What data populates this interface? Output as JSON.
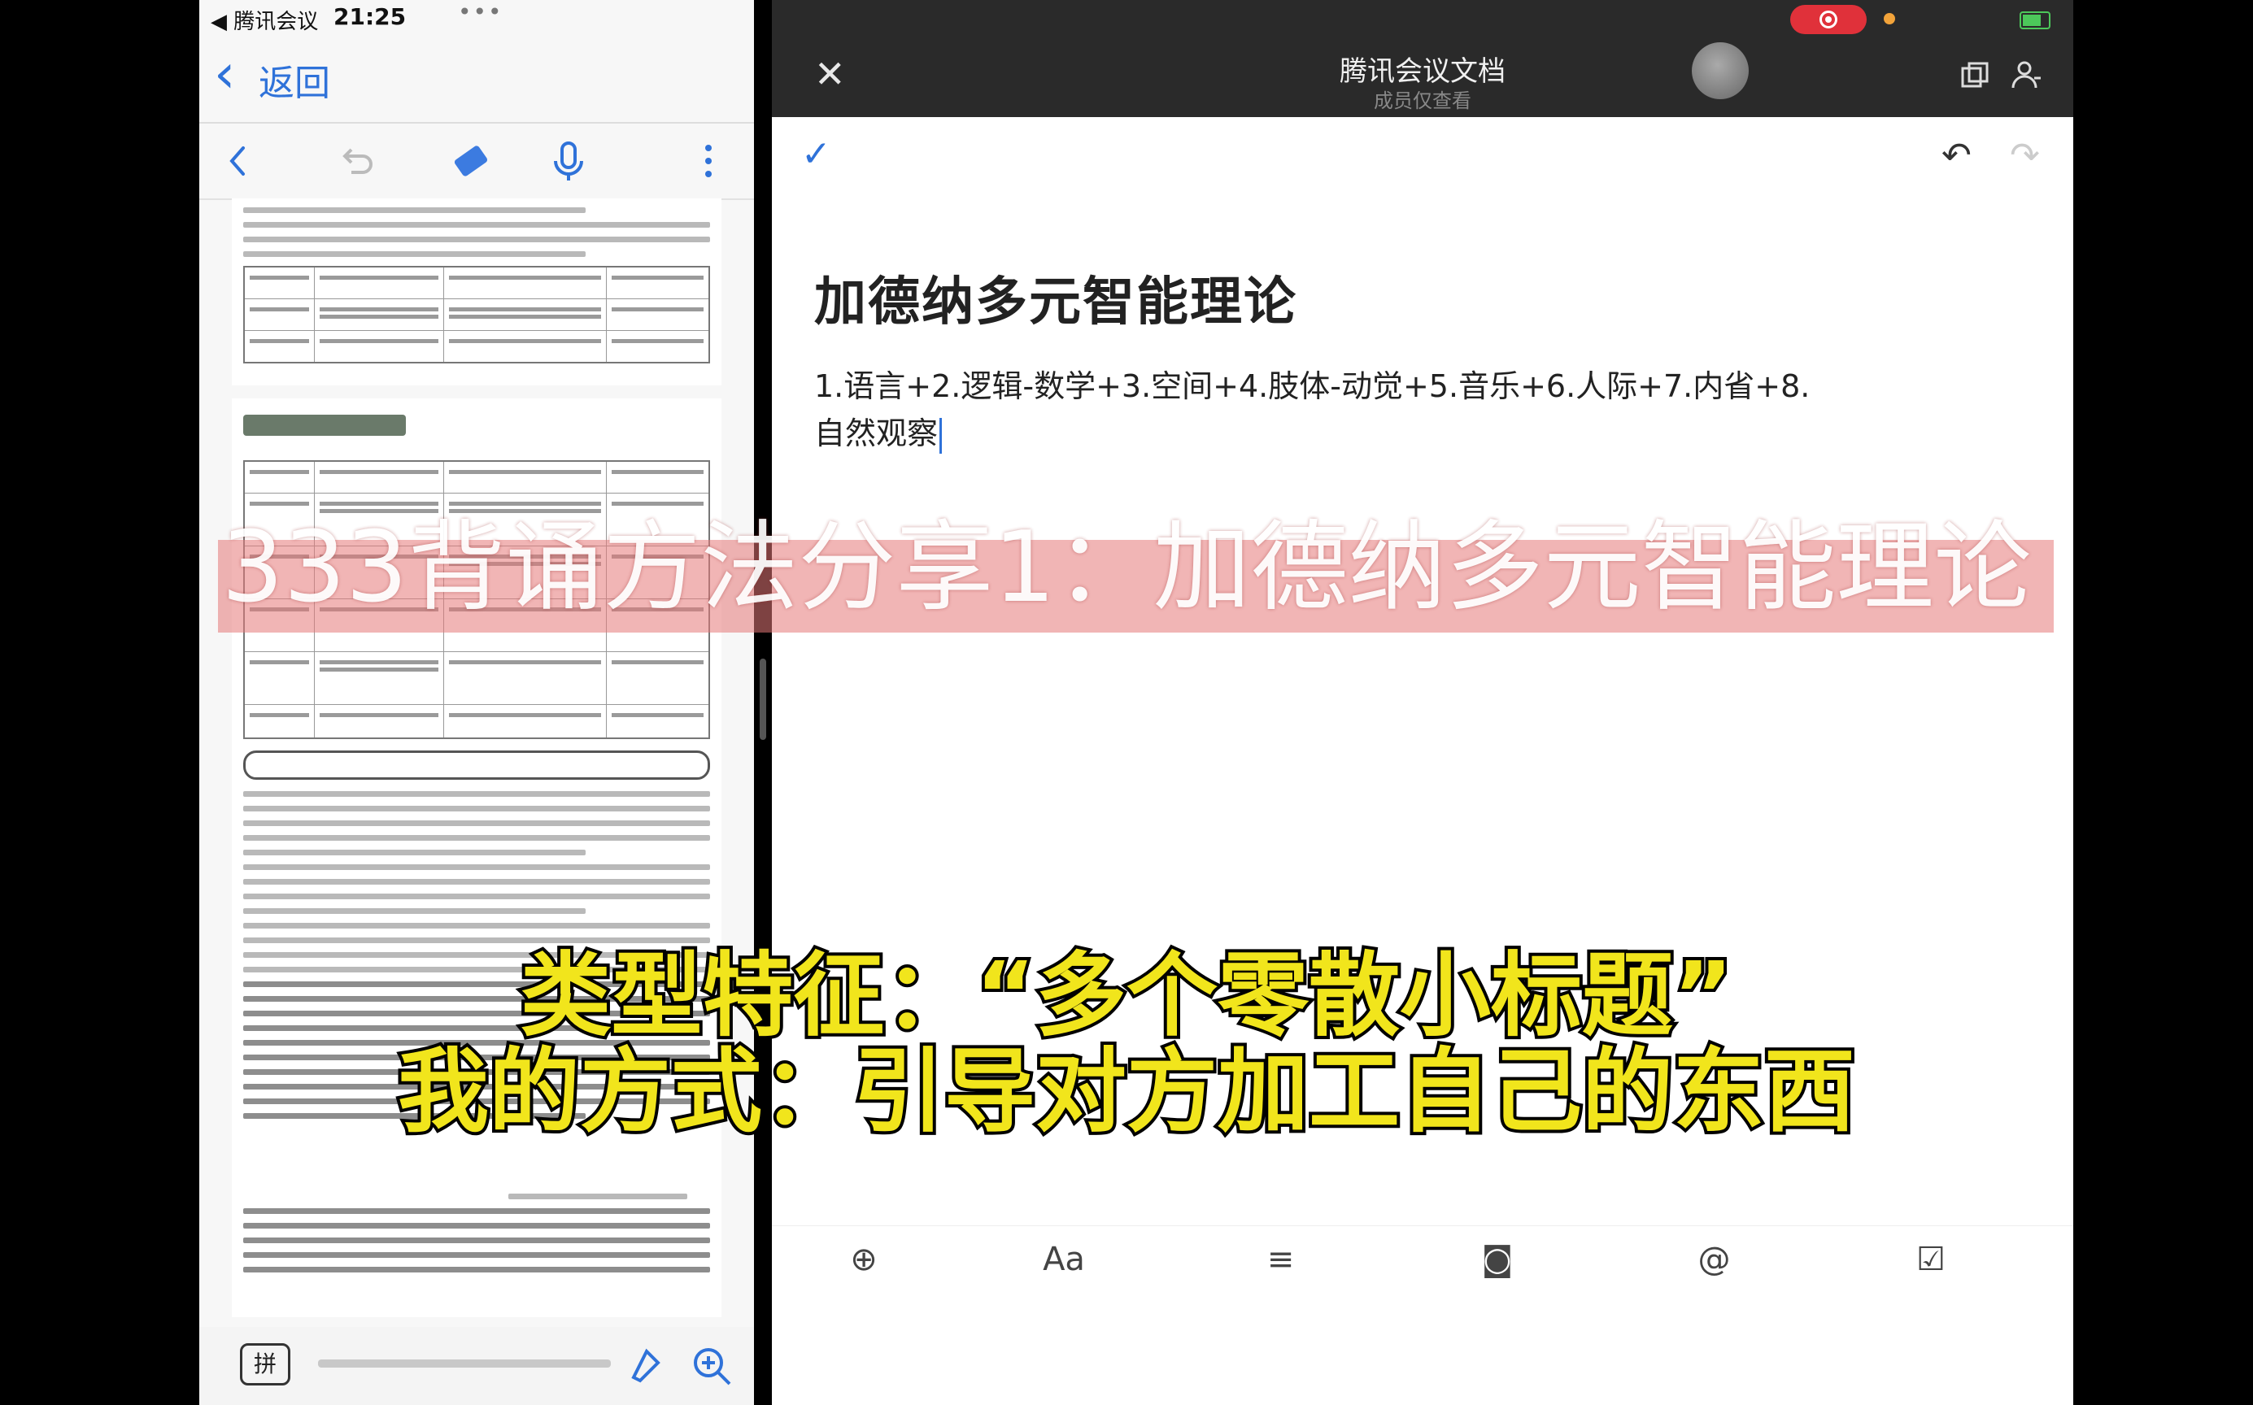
{
  "left_pane": {
    "status_app": "◀ 腾讯会议",
    "status_time": "21:25",
    "status_dots": "•••",
    "back_label": "返回",
    "bottom_input_label": "拼",
    "icons": [
      "chevron-left-icon",
      "undo-icon",
      "eraser-icon",
      "microphone-icon",
      "more-vertical-icon",
      "highlighter-icon",
      "zoom-in-icon"
    ]
  },
  "right_pane": {
    "doc_app_title": "腾讯会议文档",
    "doc_app_subtitle": "成员仅查看",
    "close_glyph": "✕",
    "check_glyph": "✓",
    "undo_glyph": "↶",
    "redo_glyph": "↷",
    "document": {
      "title": "加德纳多元智能理论",
      "body": "1.语言+2.逻辑-数学+3.空间+4.肢体-动觉+5.音乐+6.人际+7.内省+8.自然观察"
    },
    "format_bar": [
      {
        "name": "add-icon",
        "glyph": "⊕"
      },
      {
        "name": "text-style-icon",
        "glyph": "Aa"
      },
      {
        "name": "align-icon",
        "glyph": "≡"
      },
      {
        "name": "camera-icon",
        "glyph": "◙"
      },
      {
        "name": "mention-icon",
        "glyph": "@"
      },
      {
        "name": "checkbox-icon",
        "glyph": "☑"
      },
      {
        "name": "keyboard-icon",
        "glyph": "⌨"
      }
    ],
    "colors": {
      "accent": "#2f72d9",
      "header_bg": "#2a2a2a",
      "record": "#e0313a"
    }
  },
  "overlay": {
    "banner": "333背诵方法分享1：加德纳多元智能理论",
    "subtitle_line1": "类型特征：“多个零散小标题”",
    "subtitle_line2": "我的方式：引导对方加工自己的东西",
    "colors": {
      "subtitle": "#f1e51c",
      "banner_bg": "#e67878"
    }
  }
}
